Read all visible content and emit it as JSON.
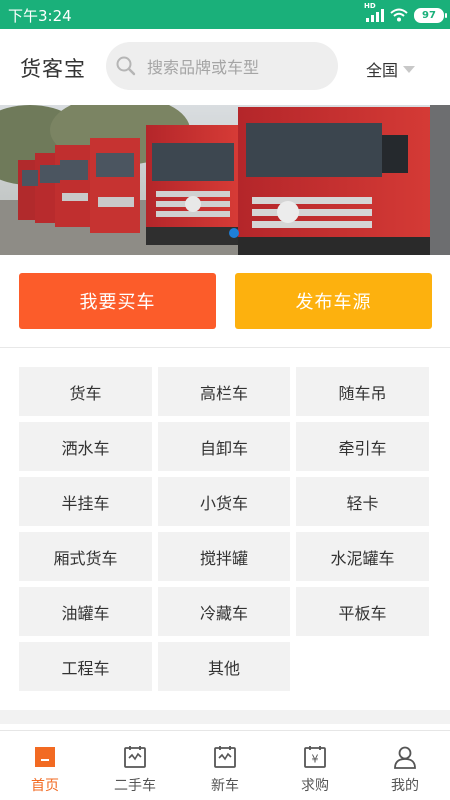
{
  "status_bar": {
    "time": "下午3:24",
    "network": "HD",
    "battery": "97"
  },
  "header": {
    "logo": "货客宝",
    "search_placeholder": "搜索品牌或车型",
    "region": "全国"
  },
  "banner": {
    "alt": "Foton Auman trucks"
  },
  "actions": {
    "buy": "我要买车",
    "publish": "发布车源"
  },
  "categories": [
    "货车",
    "高栏车",
    "随车吊",
    "洒水车",
    "自卸车",
    "牵引车",
    "半挂车",
    "小货车",
    "轻卡",
    "厢式货车",
    "搅拌罐",
    "水泥罐车",
    "油罐车",
    "冷藏车",
    "平板车",
    "工程车",
    "其他"
  ],
  "tabs": [
    {
      "label": "首页",
      "icon": "home-icon",
      "active": true
    },
    {
      "label": "二手车",
      "icon": "used-car-icon",
      "active": false
    },
    {
      "label": "新车",
      "icon": "new-car-icon",
      "active": false
    },
    {
      "label": "求购",
      "icon": "purchase-icon",
      "active": false
    },
    {
      "label": "我的",
      "icon": "profile-icon",
      "active": false
    }
  ],
  "colors": {
    "status_bar": "#1ab07a",
    "buy_button": "#fc5c2a",
    "publish_button": "#fdb10e",
    "active_tab": "#f26a22",
    "banner_dot": "#1e7fd8"
  }
}
